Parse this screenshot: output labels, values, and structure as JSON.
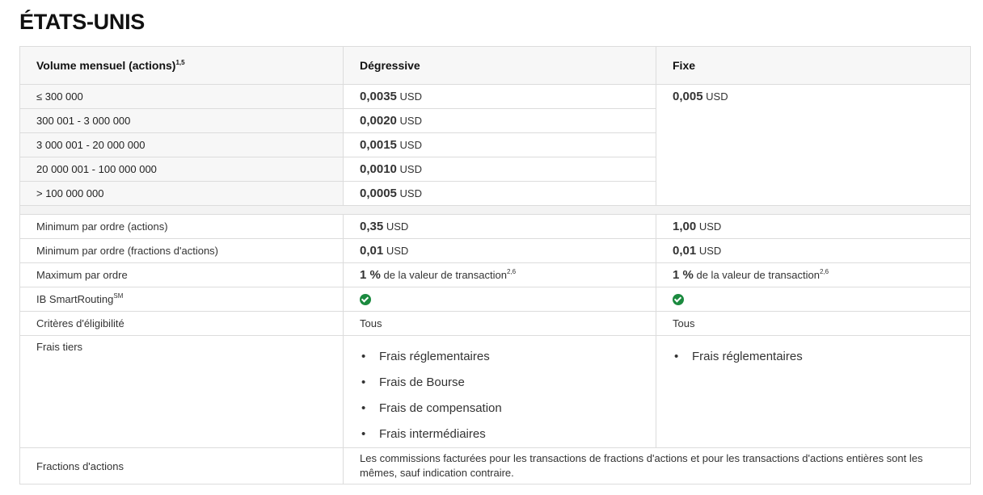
{
  "page_title": "ÉTATS-UNIS",
  "header": {
    "col1_label": "Volume mensuel (actions)",
    "col1_sup": "1,5",
    "col2_label": "Dégressive",
    "col3_label": "Fixe"
  },
  "tiers": [
    {
      "label": "≤ 300 000",
      "value": "0,0035",
      "currency": "USD"
    },
    {
      "label": "300 001 - 3 000 000",
      "value": "0,0020",
      "currency": "USD"
    },
    {
      "label": "3 000 001 - 20 000 000",
      "value": "0,0015",
      "currency": "USD"
    },
    {
      "label": "20 000 001 - 100 000 000",
      "value": "0,0010",
      "currency": "USD"
    },
    {
      "label": "> 100 000 000",
      "value": "0,0005",
      "currency": "USD"
    }
  ],
  "fixed_rate": {
    "value": "0,005",
    "currency": "USD"
  },
  "rows": {
    "min_order": {
      "label": "Minimum par ordre (actions)",
      "tiered_value": "0,35",
      "tiered_currency": "USD",
      "fixed_value": "1,00",
      "fixed_currency": "USD"
    },
    "min_fraction": {
      "label": "Minimum par ordre (fractions d'actions)",
      "tiered_value": "0,01",
      "tiered_currency": "USD",
      "fixed_value": "0,01",
      "fixed_currency": "USD"
    },
    "max_order": {
      "label": "Maximum par ordre",
      "tiered_value": "1 %",
      "tiered_text": "de la valeur de transaction",
      "tiered_sup": "2,6",
      "fixed_value": "1 %",
      "fixed_text": "de la valeur de transaction",
      "fixed_sup": "2,6"
    },
    "smart_routing": {
      "label": "IB SmartRouting",
      "label_sup": "SM",
      "tiered_icon": "check-circle-icon",
      "fixed_icon": "check-circle-icon"
    },
    "eligibility": {
      "label": "Critères d'éligibilité",
      "tiered": "Tous",
      "fixed": "Tous"
    },
    "third_party": {
      "label": "Frais tiers",
      "tiered_items": [
        "Frais réglementaires",
        "Frais de Bourse",
        "Frais de compensation",
        "Frais intermédiaires"
      ],
      "fixed_items": [
        "Frais réglementaires"
      ]
    },
    "fractions": {
      "label": "Fractions d'actions",
      "text": "Les commissions facturées pour les transactions de fractions d'actions et pour les transactions d'actions entières sont les mêmes, sauf indication contraire."
    }
  },
  "colors": {
    "check": "#1b8a3f",
    "header_bg": "#f7f7f7",
    "border": "#dcdcdc"
  }
}
